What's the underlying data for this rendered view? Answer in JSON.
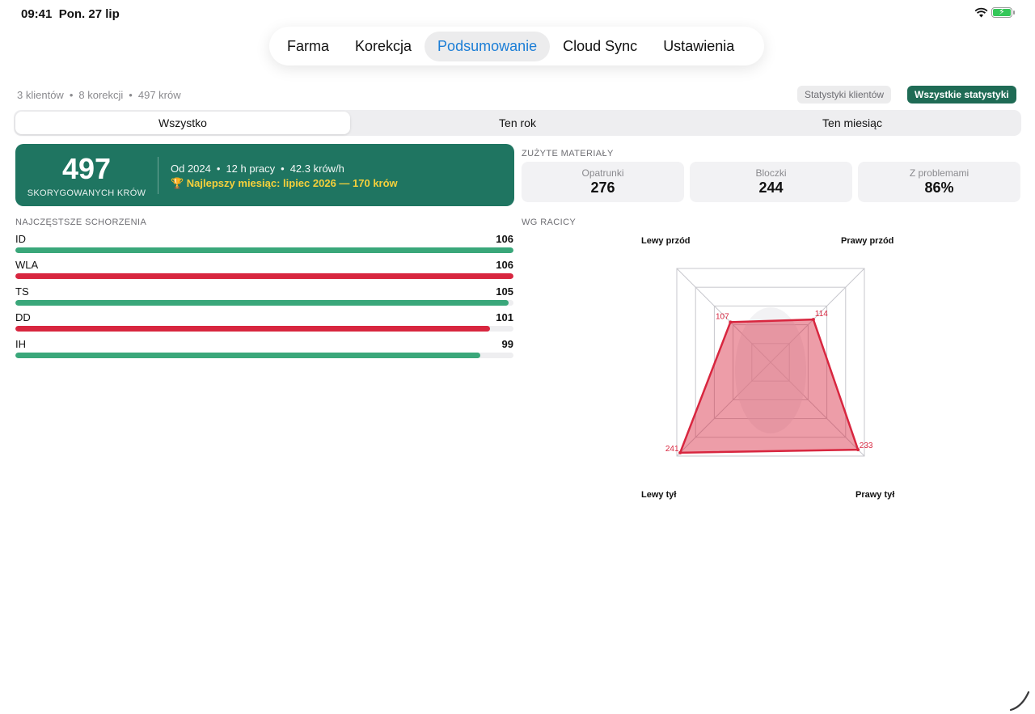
{
  "status": {
    "time": "09:41",
    "date": "Pon. 27 lip"
  },
  "nav": {
    "tabs": [
      "Farma",
      "Korekcja",
      "Podsumowanie",
      "Cloud Sync",
      "Ustawienia"
    ],
    "active_index": 2
  },
  "summary": {
    "clients": "3 klientów",
    "corrections": "8 korekcji",
    "cows": "497 krów",
    "dot": "•"
  },
  "buttons": {
    "client_stats": "Statystyki klientów",
    "all_stats": "Wszystkie statystyki"
  },
  "period": {
    "options": [
      "Wszystko",
      "Ten rok",
      "Ten miesiąc"
    ],
    "active_index": 0
  },
  "hero": {
    "count": "497",
    "count_label": "SKORYGOWANYCH KRÓW",
    "since": "Od 2024",
    "work": "12 h pracy",
    "rate": "42.3 krów/h",
    "best_month": "🏆 Najlepszy miesiąc: lipiec 2026 — 170 krów",
    "accent_color": "#1f7561",
    "highlight_color": "#f5d03b"
  },
  "materials": {
    "title": "ZUŻYTE MATERIAŁY",
    "items": [
      {
        "label": "Opatrunki",
        "value": "276"
      },
      {
        "label": "Bloczki",
        "value": "244"
      },
      {
        "label": "Z problemami",
        "value": "86%"
      }
    ]
  },
  "diseases": {
    "title": "NAJCZĘSTSZE SCHORZENIA",
    "max": 106,
    "items": [
      {
        "name": "ID",
        "value": 106,
        "color": "#3aa77a"
      },
      {
        "name": "WLA",
        "value": 106,
        "color": "#d8263f"
      },
      {
        "name": "TS",
        "value": 105,
        "color": "#3aa77a"
      },
      {
        "name": "DD",
        "value": 101,
        "color": "#d8263f"
      },
      {
        "name": "IH",
        "value": 99,
        "color": "#3aa77a"
      }
    ]
  },
  "chart_data": {
    "type": "radar",
    "title": "WG RACICY",
    "axes": [
      "Lewy przód",
      "Prawy przód",
      "Prawy tył",
      "Lewy tył"
    ],
    "values": [
      107,
      114,
      233,
      241
    ],
    "max": 250,
    "color": "#d8263f"
  }
}
